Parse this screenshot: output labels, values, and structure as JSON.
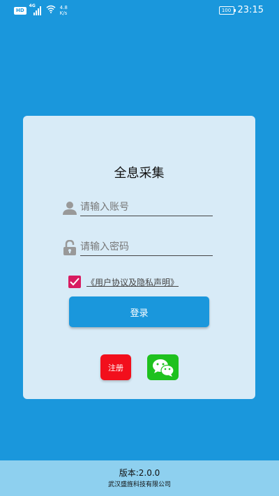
{
  "status_bar": {
    "hd_badge": "HD",
    "network": "4G",
    "speed_value": "4.8",
    "speed_unit": "K/s",
    "battery": "100",
    "time": "23:15"
  },
  "login": {
    "title": "全息采集",
    "account_placeholder": "请输入账号",
    "password_placeholder": "请输入密码",
    "agree_checked": true,
    "agreement_link": "《用户协议及隐私声明》",
    "login_button": "登录",
    "register_button": "注册",
    "wechat_icon": "wechat-icon"
  },
  "footer": {
    "version": "版本:2.0.0",
    "company": "武汉盛旌科技有限公司"
  },
  "colors": {
    "background": "#1a97dc",
    "card": "#d8ebf7",
    "primary": "#1a97dc",
    "register": "#f20f1c",
    "wechat": "#1ec11e",
    "checkbox": "#d81b60",
    "footer": "#8ed0ef"
  }
}
